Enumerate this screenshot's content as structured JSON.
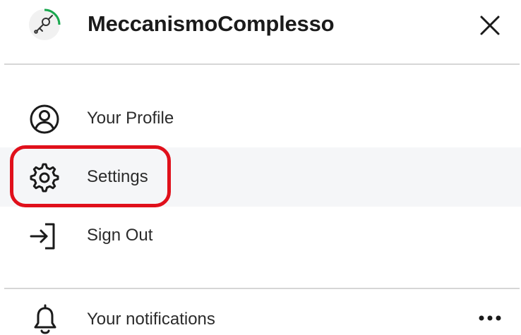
{
  "header": {
    "app_title": "MeccanismoComplesso",
    "close_icon": "close-icon",
    "logo_icon": "logo-icon"
  },
  "menu": {
    "items": [
      {
        "label": "Your Profile",
        "icon": "user-circle-icon"
      },
      {
        "label": "Settings",
        "icon": "gear-icon"
      },
      {
        "label": "Sign Out",
        "icon": "sign-out-icon"
      }
    ]
  },
  "notifications": {
    "label": "Your notifications",
    "icon": "bell-icon",
    "more_icon": "more-horizontal-icon"
  },
  "colors": {
    "highlight": "#e0101b",
    "hover_background": "#f5f6f8",
    "divider": "#d6d6d6",
    "logo_accent": "#1aa84f"
  }
}
